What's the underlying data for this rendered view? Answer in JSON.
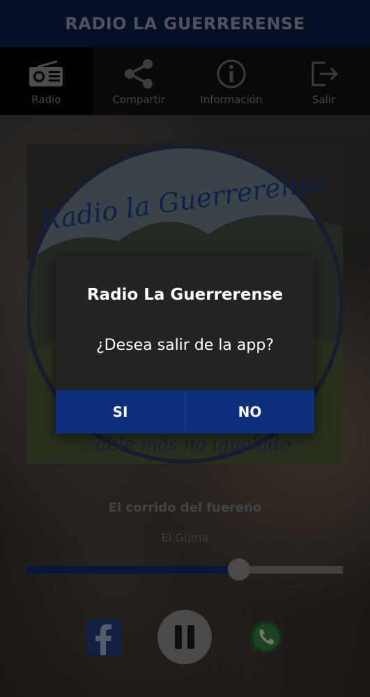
{
  "app": {
    "title": "RADIO LA GUERRERENSE"
  },
  "tabs": [
    {
      "label": "Radio",
      "icon": "radio-icon",
      "active": true
    },
    {
      "label": "Compartir",
      "icon": "share-icon",
      "active": false
    },
    {
      "label": "Información",
      "icon": "info-icon",
      "active": false
    },
    {
      "label": "Salir",
      "icon": "exit-icon",
      "active": false
    }
  ],
  "artwork": {
    "logo_text": "Radio la Guerrerense",
    "slogan_text": "...able más no igualado"
  },
  "now_playing": {
    "title": "El corrido del fuereño",
    "artist": "El Guma",
    "progress": 0.67
  },
  "controls": {
    "facebook_icon": "facebook-icon",
    "pause_icon": "pause-icon",
    "whatsapp_icon": "whatsapp-icon"
  },
  "dialog": {
    "title": "Radio La Guerrerense",
    "message": "¿Desea salir de la app?",
    "yes_label": "SI",
    "no_label": "NO"
  },
  "colors": {
    "header_bg": "#0b1d44",
    "dialog_button": "#0d2e7b",
    "accent": "#0b2a68"
  }
}
